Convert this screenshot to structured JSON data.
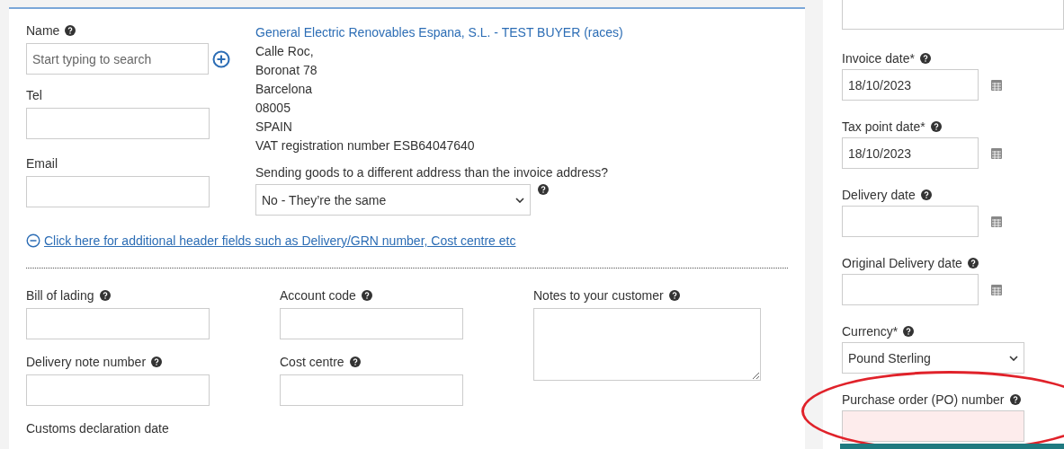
{
  "customer": {
    "name_label": "Name",
    "name_help": true,
    "name_placeholder": "Start typing to search",
    "tel_label": "Tel",
    "email_label": "Email"
  },
  "buyer": {
    "name": "General Electric Renovables Espana, S.L. - TEST BUYER (races)",
    "address_lines": [
      "Calle Roc,",
      "Boronat 78",
      "Barcelona",
      "08005",
      "SPAIN",
      "VAT registration number ESB64047640"
    ]
  },
  "delivery_question": {
    "label": "Sending goods to a different address than the invoice address?",
    "value": "No - They’re the same",
    "help": true
  },
  "additional_link": {
    "text": "Click here for additional header fields such as Delivery/GRN number, Cost centre etc",
    "expanded": true
  },
  "extra_fields": [
    {
      "label": "Bill of lading",
      "help": true,
      "kind": "input"
    },
    {
      "label": "Account code",
      "help": true,
      "kind": "input"
    },
    {
      "label": "Notes to your customer",
      "help": true,
      "kind": "textarea"
    },
    {
      "label": "Delivery note number",
      "help": true,
      "kind": "input"
    },
    {
      "label": "Cost centre",
      "help": true,
      "kind": "input"
    }
  ],
  "customs_label": "Customs declaration date",
  "side_fields": [
    {
      "label": "Invoice date*",
      "help": true,
      "kind": "date",
      "value": "18/10/2023",
      "highlighted": false
    },
    {
      "label": "Tax point date*",
      "help": true,
      "kind": "date",
      "value": "18/10/2023",
      "highlighted": false
    },
    {
      "label": "Delivery date",
      "help": true,
      "kind": "date",
      "highlighted": false
    },
    {
      "label": "Original Delivery date",
      "help": true,
      "kind": "date",
      "highlighted": false
    },
    {
      "label": "Currency*",
      "help": true,
      "kind": "select",
      "value": "Pound Sterling",
      "highlighted": false
    },
    {
      "label": "Purchase order (PO) number",
      "help": true,
      "kind": "input",
      "highlighted": true
    }
  ]
}
